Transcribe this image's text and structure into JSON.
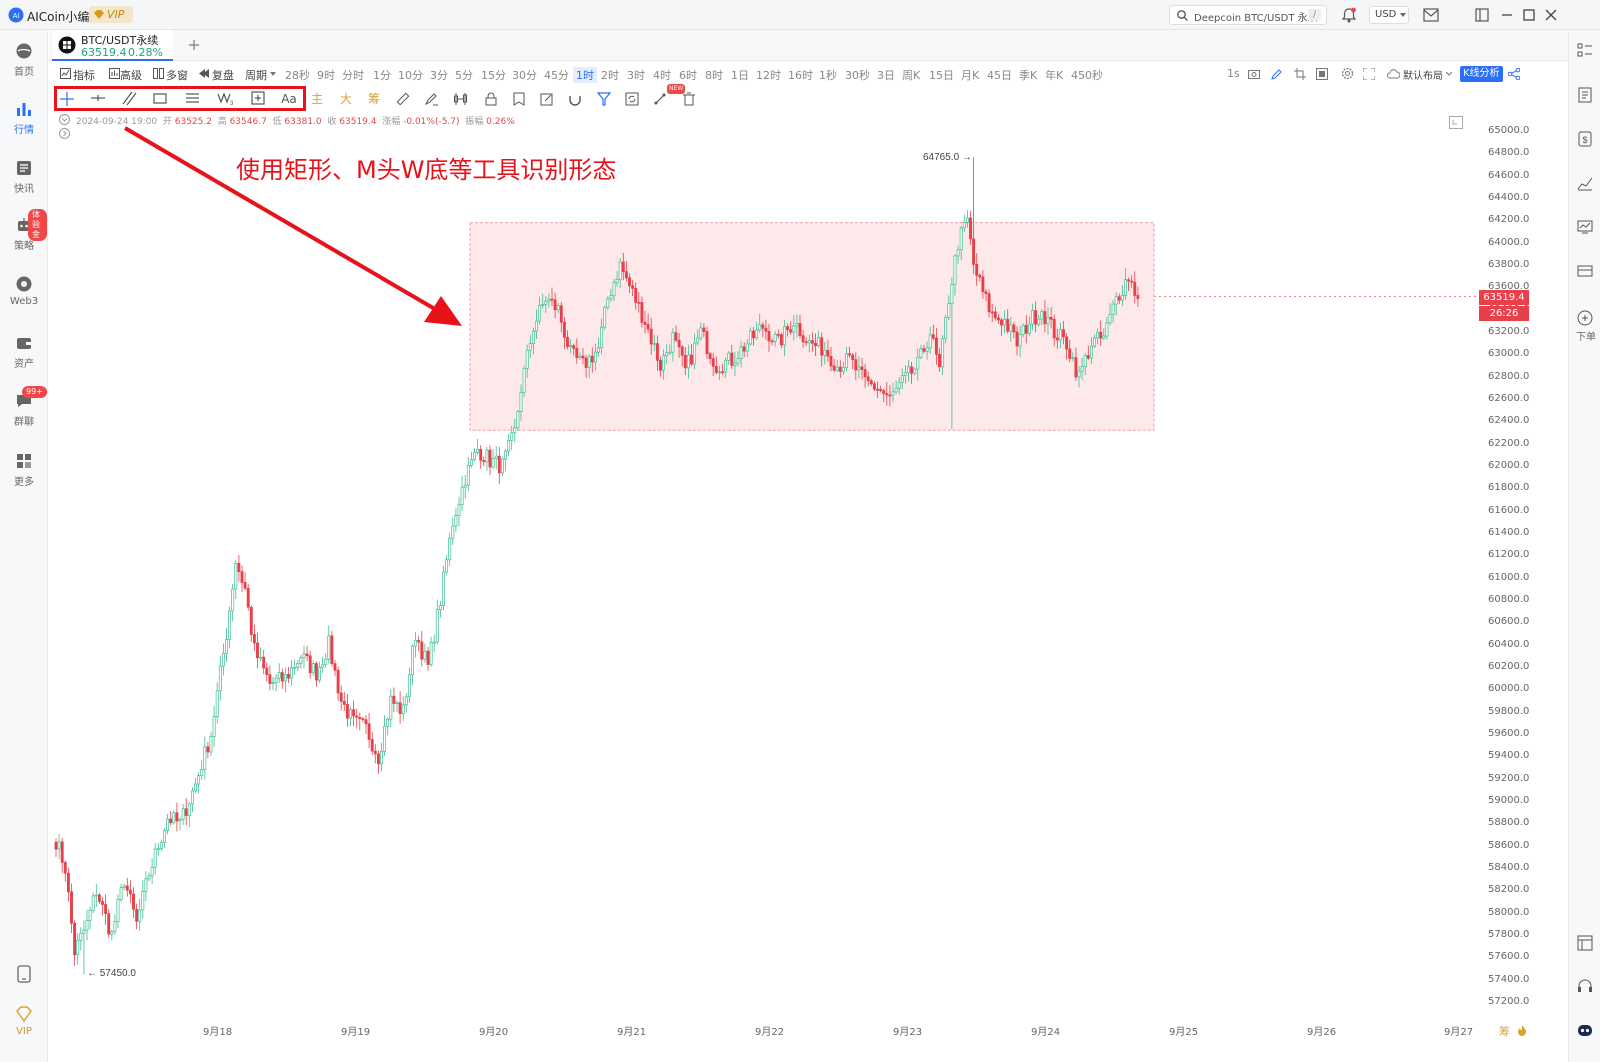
{
  "app": {
    "name": "AICoin小编",
    "vip_label": "VIP"
  },
  "titlebar": {
    "search_placeholder": "Deepcoin BTC/USDT 永续",
    "search_shortcut": "/",
    "currency": "USD"
  },
  "nav": [
    {
      "label": "首页",
      "icon": "home-icon",
      "active": false
    },
    {
      "label": "行情",
      "icon": "market-chart-icon",
      "active": true
    },
    {
      "label": "快讯",
      "icon": "news-icon",
      "active": false
    },
    {
      "label": "策略",
      "icon": "robot-icon",
      "active": false,
      "badge": "体验金"
    },
    {
      "label": "Web3",
      "icon": "web3-icon",
      "active": false
    },
    {
      "label": "资产",
      "icon": "wallet-icon",
      "active": false
    },
    {
      "label": "群聊",
      "icon": "chat-icon",
      "active": false,
      "badge": "99+"
    },
    {
      "label": "更多",
      "icon": "grid-more-icon",
      "active": false
    }
  ],
  "nav_bottom_vip": "VIP",
  "tab": {
    "symbol": "BTC/USDT永续",
    "price": "63519.4",
    "change": "0.28%"
  },
  "period_bar": {
    "tools": [
      "指标",
      "高级",
      "多窗",
      "复盘",
      "周期"
    ],
    "periods": [
      "28秒",
      "9时",
      "分时",
      "1分",
      "10分",
      "3分",
      "5分",
      "15分",
      "30分",
      "45分",
      "1时",
      "2时",
      "3时",
      "4时",
      "6时",
      "8时",
      "1日",
      "12时",
      "16时",
      "1秒",
      "30秒",
      "3日",
      "周K",
      "15日",
      "月K",
      "45日",
      "季K",
      "年K",
      "450秒"
    ],
    "selected": "1时",
    "right_interval": "1s",
    "layout_label": "默认布局",
    "kline_analysis": "K线分析"
  },
  "toolbar": {
    "text_tool": "Aa",
    "main_label": "主",
    "big_label": "大",
    "chip_label": "筹",
    "new_badge": "NEW"
  },
  "ohlc": {
    "datetime": "2024-09-24 19:00",
    "open_label": "开",
    "open": "63525.2",
    "high_label": "高",
    "high": "63546.7",
    "low_label": "低",
    "low": "63381.0",
    "close_label": "收",
    "close": "63519.4",
    "change_label": "涨幅",
    "change": "-0.01%(-5.7)",
    "amp_label": "振幅",
    "amp": "0.26%"
  },
  "annotation": {
    "text": "使用矩形、M头W底等工具识别形态"
  },
  "chart_data": {
    "type": "candlestick",
    "symbol": "BTC/USDT永续",
    "interval": "1时",
    "ylim": [
      57100,
      65100
    ],
    "y_ticks": [
      "65000.0",
      "64800.0",
      "64600.0",
      "64400.0",
      "64200.0",
      "64000.0",
      "63800.0",
      "63600.0",
      "63400.0",
      "63200.0",
      "63000.0",
      "62800.0",
      "62600.0",
      "62400.0",
      "62200.0",
      "62000.0",
      "61800.0",
      "61600.0",
      "61400.0",
      "61200.0",
      "61000.0",
      "60800.0",
      "60600.0",
      "60400.0",
      "60200.0",
      "60000.0",
      "59800.0",
      "59600.0",
      "59400.0",
      "59200.0",
      "59000.0",
      "58800.0",
      "58600.0",
      "58400.0",
      "58200.0",
      "58000.0",
      "57800.0",
      "57600.0",
      "57400.0",
      "57200.0"
    ],
    "x_ticks": [
      "9月18",
      "9月19",
      "9月20",
      "9月21",
      "9月22",
      "9月23",
      "9月24",
      "9月25",
      "9月26",
      "9月27"
    ],
    "high_marker": "64765.0",
    "low_marker": "57450.0",
    "last_price": "63519.4",
    "countdown": "26:26",
    "rectangle": {
      "price_top": 64180,
      "price_bottom": 62320,
      "from": "9月20",
      "to": "9月24"
    },
    "anchors": [
      [
        0,
        58650
      ],
      [
        3,
        58400
      ],
      [
        6,
        57650
      ],
      [
        10,
        57900
      ],
      [
        13,
        58200
      ],
      [
        18,
        57800
      ],
      [
        22,
        58300
      ],
      [
        26,
        57900
      ],
      [
        30,
        58350
      ],
      [
        36,
        58850
      ],
      [
        40,
        58800
      ],
      [
        45,
        59150
      ],
      [
        50,
        59600
      ],
      [
        55,
        60500
      ],
      [
        58,
        61150
      ],
      [
        61,
        60900
      ],
      [
        64,
        60350
      ],
      [
        69,
        60050
      ],
      [
        74,
        60100
      ],
      [
        79,
        60300
      ],
      [
        84,
        60150
      ],
      [
        88,
        60400
      ],
      [
        92,
        59900
      ],
      [
        96,
        59700
      ],
      [
        100,
        59650
      ],
      [
        104,
        59400
      ],
      [
        108,
        59900
      ],
      [
        112,
        59800
      ],
      [
        116,
        60500
      ],
      [
        120,
        60200
      ],
      [
        124,
        60800
      ],
      [
        128,
        61500
      ],
      [
        132,
        61900
      ],
      [
        136,
        62150
      ],
      [
        140,
        62050
      ],
      [
        144,
        62000
      ],
      [
        148,
        62300
      ],
      [
        150,
        62700
      ],
      [
        154,
        63250
      ],
      [
        158,
        63500
      ],
      [
        162,
        63400
      ],
      [
        166,
        63000
      ],
      [
        170,
        62900
      ],
      [
        175,
        63050
      ],
      [
        178,
        63500
      ],
      [
        182,
        63800
      ],
      [
        186,
        63550
      ],
      [
        190,
        63300
      ],
      [
        195,
        62900
      ],
      [
        199,
        63150
      ],
      [
        203,
        62850
      ],
      [
        208,
        63200
      ],
      [
        213,
        62900
      ],
      [
        218,
        62950
      ],
      [
        223,
        63100
      ],
      [
        228,
        63250
      ],
      [
        233,
        63100
      ],
      [
        238,
        63300
      ],
      [
        243,
        63100
      ],
      [
        248,
        63050
      ],
      [
        252,
        62900
      ],
      [
        256,
        62950
      ],
      [
        261,
        62750
      ],
      [
        265,
        62700
      ],
      [
        269,
        62600
      ],
      [
        273,
        62750
      ],
      [
        278,
        62900
      ],
      [
        282,
        63200
      ],
      [
        285,
        62850
      ],
      [
        288,
        63500
      ],
      [
        291,
        64000
      ],
      [
        294,
        64200
      ],
      [
        296,
        63800
      ],
      [
        299,
        63550
      ],
      [
        302,
        63350
      ],
      [
        306,
        63300
      ],
      [
        310,
        63100
      ],
      [
        314,
        63300
      ],
      [
        318,
        63400
      ],
      [
        322,
        63200
      ],
      [
        326,
        63100
      ],
      [
        330,
        62800
      ],
      [
        334,
        63100
      ],
      [
        338,
        63150
      ],
      [
        342,
        63500
      ],
      [
        346,
        63700
      ],
      [
        349,
        63500
      ]
    ]
  }
}
